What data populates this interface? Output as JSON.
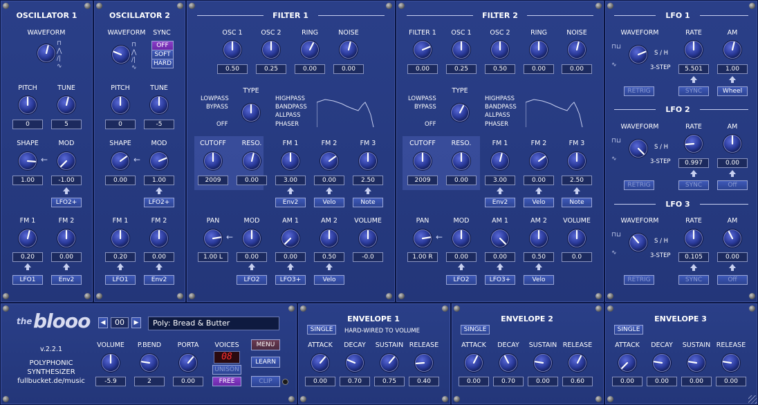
{
  "osc1": {
    "title": "OSCILLATOR 1",
    "waveform": "WAVEFORM",
    "pitch": "PITCH",
    "tune": "TUNE",
    "pitch_val": "0",
    "tune_val": "5",
    "shape": "SHAPE",
    "mod": "MOD",
    "shape_val": "1.00",
    "mod_val": "-1.00",
    "mod_src": "LFO2+",
    "fm1": "FM 1",
    "fm2": "FM 2",
    "fm1_val": "0.20",
    "fm2_val": "0.00",
    "fm1_src": "LFO1",
    "fm2_src": "Env2"
  },
  "osc2": {
    "title": "OSCILLATOR 2",
    "waveform": "WAVEFORM",
    "sync": "SYNC",
    "sync_off": "OFF",
    "sync_soft": "SOFT",
    "sync_hard": "HARD",
    "pitch": "PITCH",
    "tune": "TUNE",
    "pitch_val": "0",
    "tune_val": "-5",
    "shape": "SHAPE",
    "mod": "MOD",
    "shape_val": "0.00",
    "mod_val": "1.00",
    "mod_src": "LFO2+",
    "fm1": "FM 1",
    "fm2": "FM 2",
    "fm1_val": "0.20",
    "fm2_val": "0.00",
    "fm1_src": "LFO1",
    "fm2_src": "Env2"
  },
  "filter1": {
    "title": "FILTER 1",
    "osc1": "OSC 1",
    "osc2": "OSC 2",
    "ring": "RING",
    "noise": "NOISE",
    "osc1_val": "0.50",
    "osc2_val": "0.25",
    "ring_val": "0.00",
    "noise_val": "0.00",
    "type": "TYPE",
    "lowpass": "LOWPASS",
    "bypass": "BYPASS",
    "off": "OFF",
    "highpass": "HIGHPASS",
    "bandpass": "BANDPASS",
    "allpass": "ALLPASS",
    "phaser": "PHASER",
    "cutoff": "CUTOFF",
    "reso": "RESO.",
    "fm1": "FM 1",
    "fm2": "FM 2",
    "fm3": "FM 3",
    "cutoff_val": "2009",
    "reso_val": "0.00",
    "fm1_val": "3.00",
    "fm2_val": "0.00",
    "fm3_val": "2.50",
    "fm1_src": "Env2",
    "fm2_src": "Velo",
    "fm3_src": "Note",
    "pan": "PAN",
    "mod": "MOD",
    "am1": "AM 1",
    "am2": "AM 2",
    "volume": "VOLUME",
    "pan_val": "1.00 L",
    "mod_val": "0.00",
    "am1_val": "0.00",
    "am2_val": "0.50",
    "volume_val": "-0.0",
    "mod_src": "LFO2",
    "am1_src": "LFO3+",
    "am2_src": "Velo"
  },
  "filter2": {
    "title": "FILTER 2",
    "f1": "FILTER 1",
    "osc1": "OSC 1",
    "osc2": "OSC 2",
    "ring": "RING",
    "noise": "NOISE",
    "f1_val": "0.00",
    "osc1_val": "0.25",
    "osc2_val": "0.50",
    "ring_val": "0.00",
    "noise_val": "0.00",
    "type": "TYPE",
    "lowpass": "LOWPASS",
    "bypass": "BYPASS",
    "off": "OFF",
    "highpass": "HIGHPASS",
    "bandpass": "BANDPASS",
    "allpass": "ALLPASS",
    "phaser": "PHASER",
    "cutoff": "CUTOFF",
    "reso": "RESO.",
    "fm1": "FM 1",
    "fm2": "FM 2",
    "fm3": "FM 3",
    "cutoff_val": "2009",
    "reso_val": "0.00",
    "fm1_val": "3.00",
    "fm2_val": "0.00",
    "fm3_val": "2.50",
    "fm1_src": "Env2",
    "fm2_src": "Velo",
    "fm3_src": "Note",
    "pan": "PAN",
    "mod": "MOD",
    "am1": "AM 1",
    "am2": "AM 2",
    "volume": "VOLUME",
    "pan_val": "1.00 R",
    "mod_val": "0.00",
    "am1_val": "0.00",
    "am2_val": "0.50",
    "volume_val": "0.0",
    "mod_src": "LFO2",
    "am1_src": "LFO3+",
    "am2_src": "Velo"
  },
  "lfo1": {
    "title": "LFO 1",
    "waveform": "WAVEFORM",
    "rate": "RATE",
    "am": "AM",
    "sh": "S / H",
    "step": "3-STEP",
    "rate_val": "5.501",
    "am_val": "1.00",
    "retrig": "RETRIG",
    "sync": "SYNC",
    "am_src": "Wheel"
  },
  "lfo2": {
    "title": "LFO 2",
    "waveform": "WAVEFORM",
    "rate": "RATE",
    "am": "AM",
    "sh": "S / H",
    "step": "3-STEP",
    "rate_val": "0.997",
    "am_val": "0.00",
    "retrig": "RETRIG",
    "sync": "SYNC",
    "am_src": "Off"
  },
  "lfo3": {
    "title": "LFO 3",
    "waveform": "WAVEFORM",
    "rate": "RATE",
    "am": "AM",
    "sh": "S / H",
    "step": "3-STEP",
    "rate_val": "0.105",
    "am_val": "0.00",
    "retrig": "RETRIG",
    "sync": "SYNC",
    "am_src": "Off"
  },
  "main": {
    "logo_the": "the",
    "logo_name": "blooo",
    "version": "v.2.2.1",
    "desc1": "POLYPHONIC",
    "desc2": "SYNTHESIZER",
    "url": "fullbucket.de/music",
    "prog_num": "00",
    "prog_name": "Poly: Bread & Butter",
    "volume": "VOLUME",
    "pbend": "P.BEND",
    "porta": "PORTA",
    "voices": "VOICES",
    "volume_val": "-5.9",
    "pbend_val": "2",
    "porta_val": "0.00",
    "voices_val": "08",
    "unison": "UNISON",
    "free": "FREE",
    "menu": "MENU",
    "learn": "LEARN",
    "clip": "CLIP"
  },
  "env1": {
    "title": "ENVELOPE 1",
    "single": "SINGLE",
    "note": "HARD-WIRED TO VOLUME",
    "attack": "ATTACK",
    "decay": "DECAY",
    "sustain": "SUSTAIN",
    "release": "RELEASE",
    "attack_val": "0.00",
    "decay_val": "0.70",
    "sustain_val": "0.75",
    "release_val": "0.40"
  },
  "env2": {
    "title": "ENVELOPE 2",
    "single": "SINGLE",
    "attack": "ATTACK",
    "decay": "DECAY",
    "sustain": "SUSTAIN",
    "release": "RELEASE",
    "attack_val": "0.00",
    "decay_val": "0.70",
    "sustain_val": "0.00",
    "release_val": "0.60"
  },
  "env3": {
    "title": "ENVELOPE 3",
    "single": "SINGLE",
    "attack": "ATTACK",
    "decay": "DECAY",
    "sustain": "SUSTAIN",
    "release": "RELEASE",
    "attack_val": "0.00",
    "decay_val": "0.00",
    "sustain_val": "0.00",
    "release_val": "0.00"
  },
  "knob_values": [
    0.55,
    0.5,
    0.55,
    0.85,
    0.0,
    0.55,
    0.5,
    0.25,
    0.5,
    0.5,
    0.7,
    0.75,
    0.5,
    0.5,
    0.5,
    0.5,
    0.6,
    0.55,
    0.5,
    0.5,
    0.55,
    0.5,
    0.7,
    0.5,
    0.8,
    0.5,
    0.0,
    0.5,
    0.5,
    0.75,
    0.5,
    0.5,
    0.5,
    0.55,
    0.6,
    0.5,
    0.5,
    0.55,
    0.7,
    0.5,
    0.8,
    0.5,
    1.0,
    0.5,
    0.5,
    0.75,
    0.5,
    0.55,
    1.0,
    0.15,
    0.5,
    0.35,
    0.5,
    0.4,
    0.5,
    0.2,
    0.65,
    0.65,
    0.25,
    0.65,
    0.15,
    0.6,
    0.4,
    0.2,
    0.6,
    0.0,
    0.2,
    0.2,
    0.2,
    0.2
  ]
}
